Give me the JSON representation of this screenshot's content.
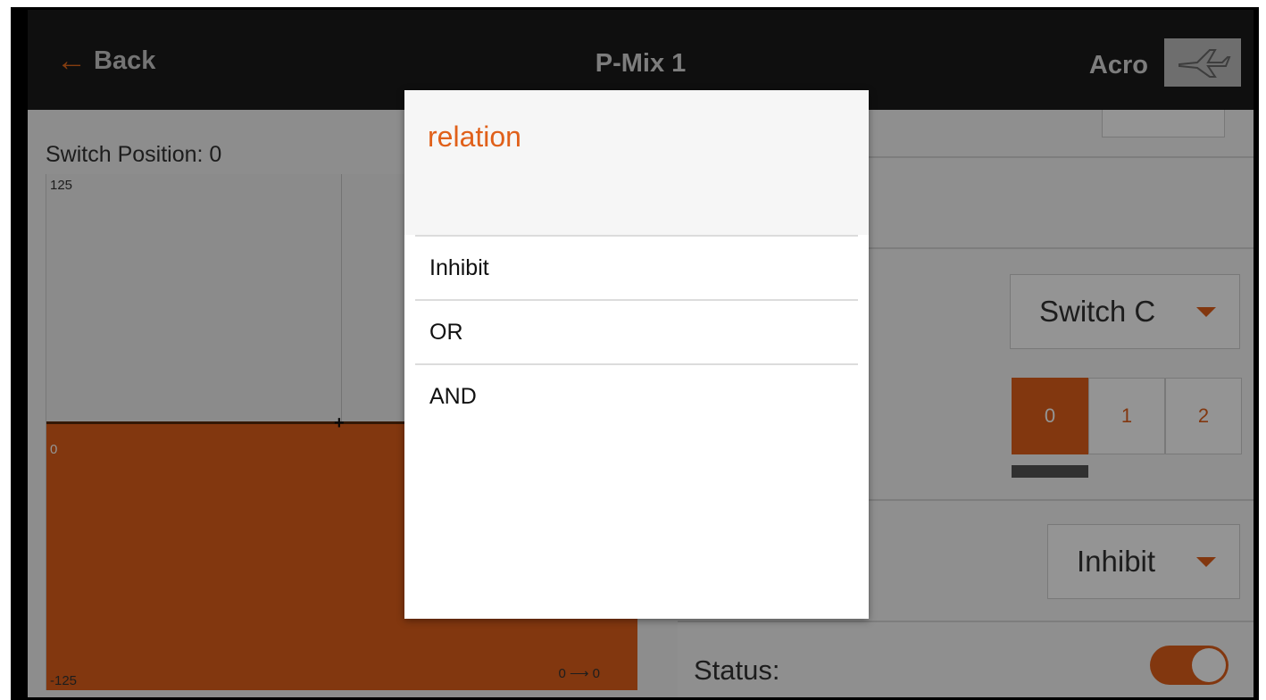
{
  "header": {
    "back_label": "Back",
    "title": "P-Mix 1",
    "mode": "Acro",
    "model_icon": "airplane-icon"
  },
  "graph": {
    "switch_position_label": "Switch Position: 0",
    "y_max": "125",
    "y_mid": "0",
    "y_min": "-125",
    "range_text": "0 ⟶ 0"
  },
  "settings": {
    "switch_value": "Switch C",
    "positions": [
      "0",
      "1",
      "2"
    ],
    "selected_position": "0",
    "relation_value": "Inhibit",
    "status_label": "Status:"
  },
  "dialog": {
    "title": "relation",
    "options": [
      "Inhibit",
      "OR",
      "AND"
    ]
  },
  "colors": {
    "accent": "#e0601a",
    "header": "#1b1b1b"
  }
}
